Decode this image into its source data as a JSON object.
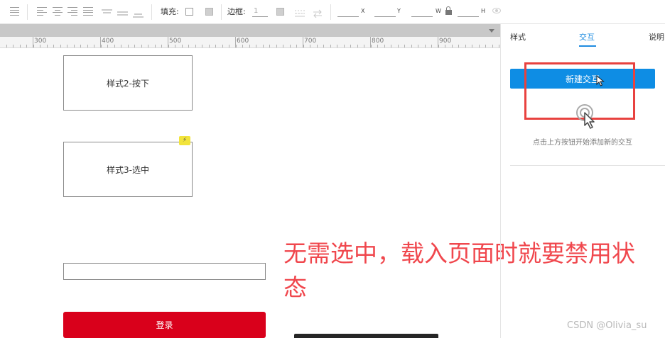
{
  "toolbar": {
    "fill_label": "填充:",
    "border_label": "边框:",
    "border_value": "1",
    "coord_labels": {
      "x": "X",
      "y": "Y",
      "w": "W",
      "h": "H"
    }
  },
  "ruler": {
    "labels": [
      "300",
      "400",
      "500",
      "600",
      "700",
      "800",
      "900"
    ]
  },
  "canvas": {
    "widget_pressed_label": "样式2-按下",
    "widget_selected_label": "样式3-选中",
    "lightning_icon": "⚡",
    "login_button_label": "登录",
    "annotation_text": "无需选中，载入页面时就要禁用状态",
    "watermark": "CSDN @Olivia_su"
  },
  "panel": {
    "tabs": [
      {
        "label": "样式",
        "active": false
      },
      {
        "label": "交互",
        "active": true
      },
      {
        "label": "说明",
        "active": false
      }
    ],
    "new_interaction_label": "新建交互",
    "hint": "点击上方按钮开始添加新的交互"
  },
  "colors": {
    "accent_blue": "#0e8de4",
    "login_red": "#d9001b",
    "annotation_red": "#f0474d",
    "highlight_red": "#e8423f",
    "badge_yellow": "#f2e43b"
  },
  "icons": {
    "toolbar": [
      "list-icon",
      "align-left-icon",
      "align-center-icon",
      "align-right-icon",
      "justify-icon",
      "valign-top-icon",
      "valign-middle-icon",
      "valign-bottom-icon"
    ],
    "panel": [
      "touch-gesture-icon",
      "mouse-cursor-icon"
    ]
  }
}
